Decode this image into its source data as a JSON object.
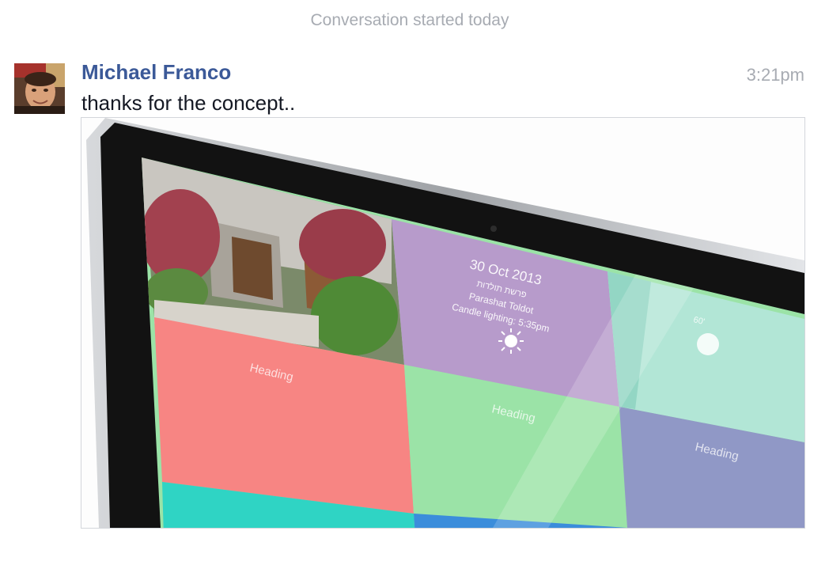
{
  "conversation": {
    "header": "Conversation started today"
  },
  "message": {
    "author": "Michael Franco",
    "time": "3:21pm",
    "text": "thanks for the concept..",
    "attachment": {
      "screen_tiles": {
        "date": "30 Oct 2013",
        "hebrew_line": "פרשת תולדות",
        "parasha": "Parashat Toldot",
        "candle_lighting": "Candle lighting: 5:35pm",
        "heading_label": "Heading",
        "small_number": "60'"
      },
      "colors": {
        "bezel": "#111111",
        "frame": "#c4c6c9",
        "lilac": "#b79bcb",
        "salmon": "#f78583",
        "mint": "#9be3a7",
        "pale_teal": "#b2e6d6",
        "indigo": "#9098c6",
        "turquoise": "#2fd4c4",
        "blue": "#3b8ddb"
      }
    }
  }
}
